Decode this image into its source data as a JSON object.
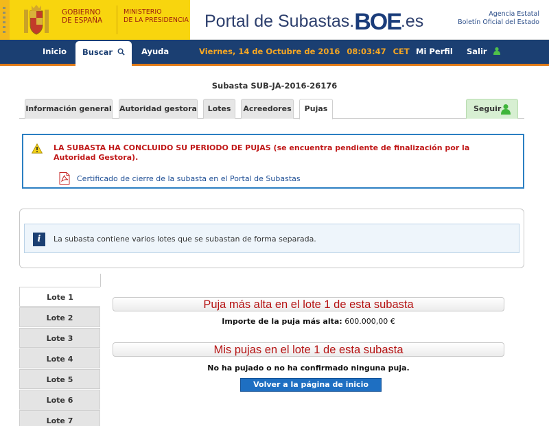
{
  "header": {
    "gov_line1": "GOBIERNO",
    "gov_line2": "DE ESPAÑA",
    "ministry_line1": "MINISTERIO",
    "ministry_line2": "DE LA PRESIDENCIA",
    "portal_prefix": "Portal de Subastas.",
    "portal_brand": "BOE",
    "portal_suffix": ".es",
    "agency_line1": "Agencia Estatal",
    "agency_line2": "Boletín Oficial del Estado",
    "brand_yellow": "#f8d50e",
    "brand_red": "#9b1b10"
  },
  "nav": {
    "home": "Inicio",
    "search": "Buscar",
    "help": "Ayuda",
    "date": "Viernes, 14 de Octubre de 2016",
    "time": "08:03:47",
    "timezone": "CET",
    "profile": "Mi Perfil",
    "logout": "Salir",
    "bar_color": "#1b3f72",
    "accent_color": "#e07a16"
  },
  "auction": {
    "title": "Subasta SUB-JA-2016-26176"
  },
  "tabs": [
    {
      "label": "Información general",
      "active": false
    },
    {
      "label": "Autoridad gestora",
      "active": false
    },
    {
      "label": "Lotes",
      "active": false
    },
    {
      "label": "Acreedores",
      "active": false
    },
    {
      "label": "Pujas",
      "active": true
    }
  ],
  "follow_label": "Seguir",
  "alert": {
    "message": "LA SUBASTA HA CONCLUIDO SU PERIODO DE PUJAS (se encuentra pendiente de finalización por la Autoridad Gestora).",
    "link": "Certificado de cierre de la subasta en el Portal de Subastas",
    "icon": "warning-icon",
    "border_color": "#2b7fc2"
  },
  "info": {
    "text": "La subasta contiene varios lotes que se subastan de forma separada.",
    "icon_glyph": "i"
  },
  "lots": [
    "Lote 1",
    "Lote 2",
    "Lote 3",
    "Lote 4",
    "Lote 5",
    "Lote 6",
    "Lote 7"
  ],
  "active_lot": "Lote 1",
  "bids": {
    "highest_title": "Puja más alta en el lote 1 de esta subasta",
    "highest_label": "Importe de la puja más alta:",
    "highest_value": "600.000,00 €",
    "mine_title": "Mis pujas en el lote 1 de esta subasta",
    "mine_none": "No ha pujado o no ha confirmado ninguna puja.",
    "back_button": "Volver a la página de inicio"
  }
}
